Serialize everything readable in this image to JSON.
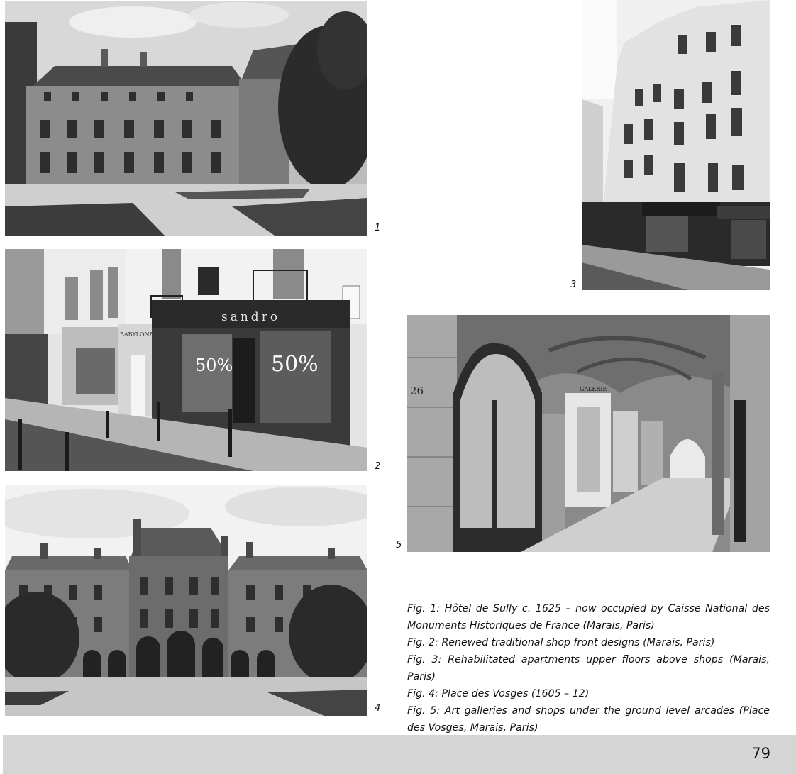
{
  "figures": [
    {
      "number": "1"
    },
    {
      "number": "2",
      "shop_name": "sandro",
      "sign_text": "50%",
      "shop_label": "BABYLONE"
    },
    {
      "number": "3"
    },
    {
      "number": "4"
    },
    {
      "number": "5",
      "door_number": "26",
      "gallery_sign": "GALERIE"
    }
  ],
  "captions": [
    "Fig. 1: Hôtel de Sully c. 1625 – now occupied by Caisse National des Monuments Historiques de France (Marais, Paris)",
    "Fig. 2: Renewed traditional shop front designs (Marais, Paris)",
    "Fig. 3: Rehabilitated apartments upper floors above shops (Marais, Paris)",
    "Fig. 4: Place des Vosges (1605 – 12)",
    "Fig. 5: Art galleries and shops under the ground level arcades  (Place des Vosges, Marais, Paris)"
  ],
  "page_number": "79"
}
